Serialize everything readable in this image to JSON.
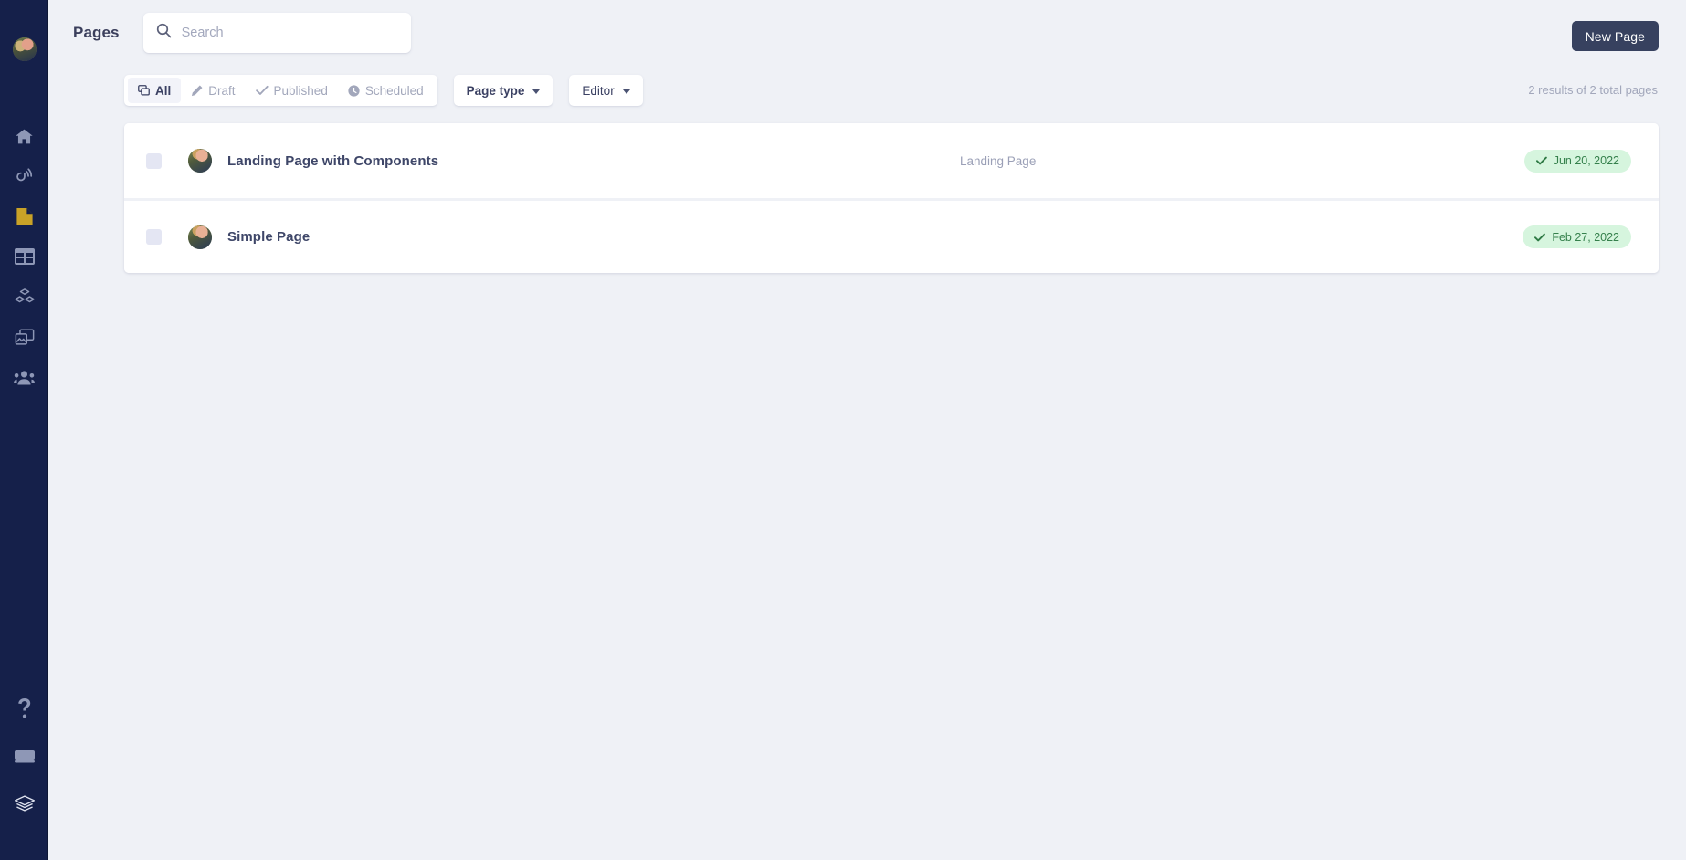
{
  "sidebar": {
    "avatar": {
      "name": "user-avatar"
    },
    "items": [
      {
        "id": "home",
        "icon": "home-icon",
        "label": "Home",
        "active": false
      },
      {
        "id": "posts",
        "icon": "broadcast-icon",
        "label": "Posts",
        "active": false
      },
      {
        "id": "pages",
        "icon": "page-icon",
        "label": "Pages",
        "active": true
      },
      {
        "id": "collections",
        "icon": "table-icon",
        "label": "Collections",
        "active": false
      },
      {
        "id": "components",
        "icon": "blocks-icon",
        "label": "Components",
        "active": false
      },
      {
        "id": "media",
        "icon": "media-icon",
        "label": "Media",
        "active": false
      },
      {
        "id": "users",
        "icon": "users-icon",
        "label": "Users",
        "active": false
      }
    ],
    "bottom_items": [
      {
        "id": "help",
        "icon": "question-mark-icon",
        "label": "Help"
      },
      {
        "id": "preview",
        "icon": "screen-icon",
        "label": "Preview"
      },
      {
        "id": "layers",
        "icon": "layers-icon",
        "label": "Layers"
      }
    ]
  },
  "header": {
    "title": "Pages",
    "search": {
      "placeholder": "Search",
      "value": "",
      "icon": "search-icon"
    },
    "new_page_button": "New Page"
  },
  "filters": {
    "tabs": [
      {
        "id": "all",
        "label": "All",
        "icon": "pages-copy-icon",
        "active": true
      },
      {
        "id": "draft",
        "label": "Draft",
        "icon": "pencil-icon",
        "active": false
      },
      {
        "id": "published",
        "label": "Published",
        "icon": "check-icon",
        "active": false
      },
      {
        "id": "scheduled",
        "label": "Scheduled",
        "icon": "clock-icon",
        "active": false
      }
    ],
    "dropdowns": [
      {
        "id": "page-type",
        "label": "Page type",
        "bold": true
      },
      {
        "id": "editor",
        "label": "Editor",
        "bold": false
      }
    ],
    "results_count": "2 results of 2 total pages"
  },
  "list": {
    "rows": [
      {
        "title": "Landing Page with Components",
        "type": "Landing Page",
        "status_icon": "check-icon",
        "date": "Jun 20, 2022",
        "checked": false
      },
      {
        "title": "Simple Page",
        "type": "",
        "status_icon": "check-icon",
        "date": "Feb 27, 2022",
        "checked": false
      }
    ]
  },
  "colors": {
    "sidebar_bg": "#15204a",
    "canvas_bg": "#eff1f6",
    "accent_page_icon": "#c9a227",
    "primary_button": "#37415f",
    "badge_bg": "#d6f5de",
    "badge_text": "#35804c",
    "title_text": "#3e4668"
  }
}
